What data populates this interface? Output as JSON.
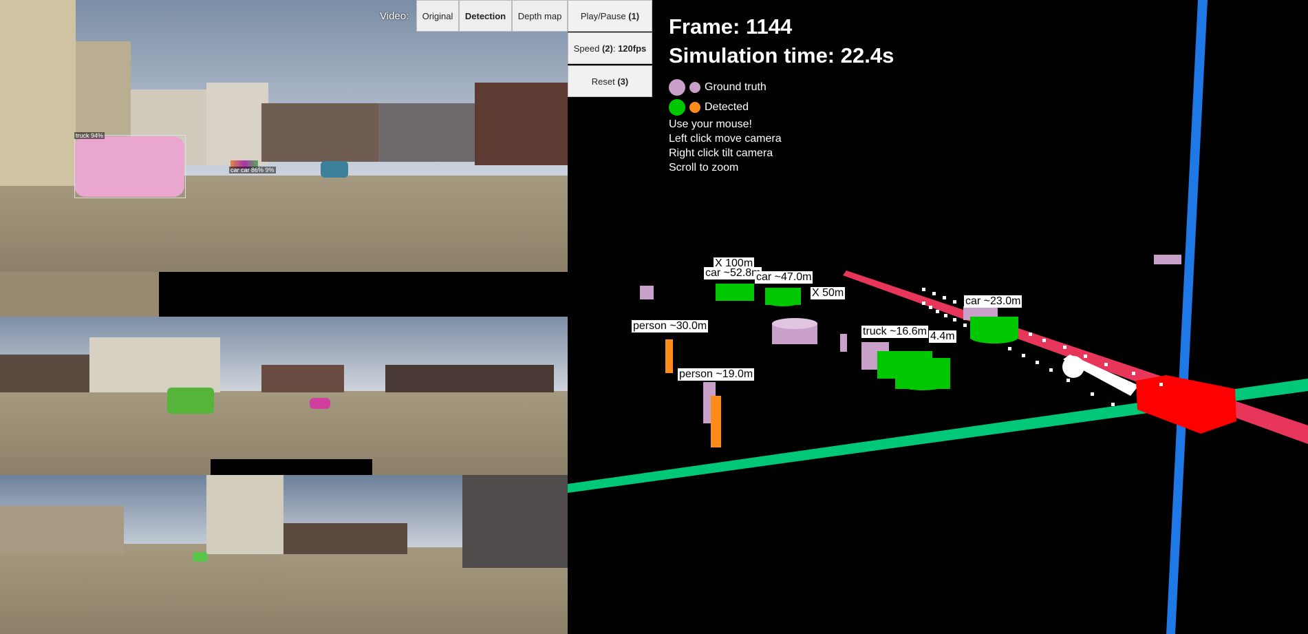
{
  "video": {
    "label": "Video:",
    "buttons": [
      "Original",
      "Detection",
      "Depth map"
    ],
    "active": "Detection"
  },
  "controls": {
    "play_pause": "Play/Pause",
    "play_pause_key": "(1)",
    "speed": "Speed",
    "speed_key": "(2)",
    "speed_value": "120fps",
    "reset": "Reset",
    "reset_key": "(3)"
  },
  "stats": {
    "frame": "Frame: 1144",
    "sim_time": "Simulation time: 22.4s"
  },
  "legend": {
    "ground_truth": "Ground truth",
    "detected": "Detected",
    "colors": {
      "ground_truth": "#c9a0c9",
      "detected_large": "#00c800",
      "detected_small": "#ff8c1a"
    }
  },
  "instructions": [
    "Use your mouse!",
    "Left click move camera",
    "Right click tilt camera",
    "Scroll to zoom"
  ],
  "camera_tags": {
    "truck": "truck 94%",
    "cars": "car car 86% 9%"
  },
  "scene_labels": {
    "x100": "X 100m",
    "car1": "car ~52.8m",
    "car2": "car ~47.0m",
    "x50": "X 50m",
    "car3": "car ~23.0m",
    "person1": "person ~30.0m",
    "truck": "truck ~16.6m",
    "near": "4.4m",
    "person2": "person ~19.0m"
  },
  "axis_colors": {
    "x": "#e8355a",
    "y": "#00c878",
    "z": "#1e78e6",
    "ego": "#ff0000"
  }
}
